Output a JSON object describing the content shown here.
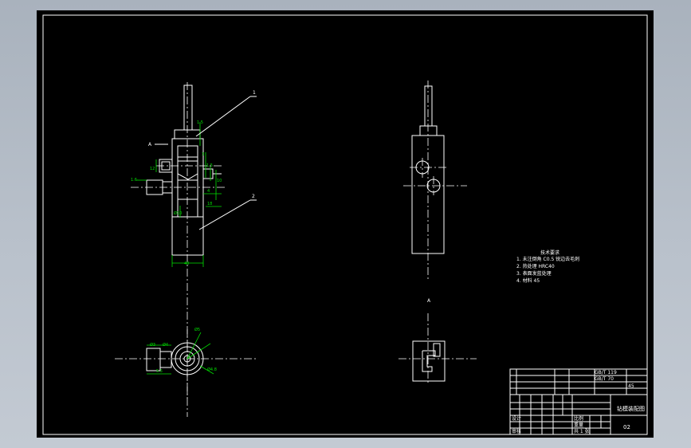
{
  "drawing": {
    "label_A": "A",
    "balloon_1": "1",
    "balloon_2": "2",
    "section_mark": "A",
    "dims_front": {
      "d1": "1.5",
      "d2": "3",
      "d3": "1.5",
      "d4": "10",
      "d5": "4",
      "d6": "18",
      "d7": "12",
      "d8": "1.6",
      "d9": "40",
      "d10": "Ø10"
    },
    "dims_bottom": {
      "b1": "Ø3",
      "b2": "Ø4",
      "b3": "5.5",
      "b4": "Ø5",
      "b5": "Ø4.8"
    }
  },
  "notes": {
    "title": "技术要求",
    "lines": [
      "1. 未注倒角 C0.5 锐边去毛刺",
      "2. 热处理 HRC40",
      "3. 表面发蓝处理",
      "4. 材料 45"
    ]
  },
  "title_block": {
    "part_name": "钻模装配图",
    "drawing_no": "02",
    "material": "45",
    "std1": "GB/T 119",
    "std2": "GB/T 70",
    "scale_label": "比例",
    "weight_label": "重量",
    "designer_label": "设计",
    "checker_label": "审核",
    "sheet_label": "共 1 张"
  }
}
